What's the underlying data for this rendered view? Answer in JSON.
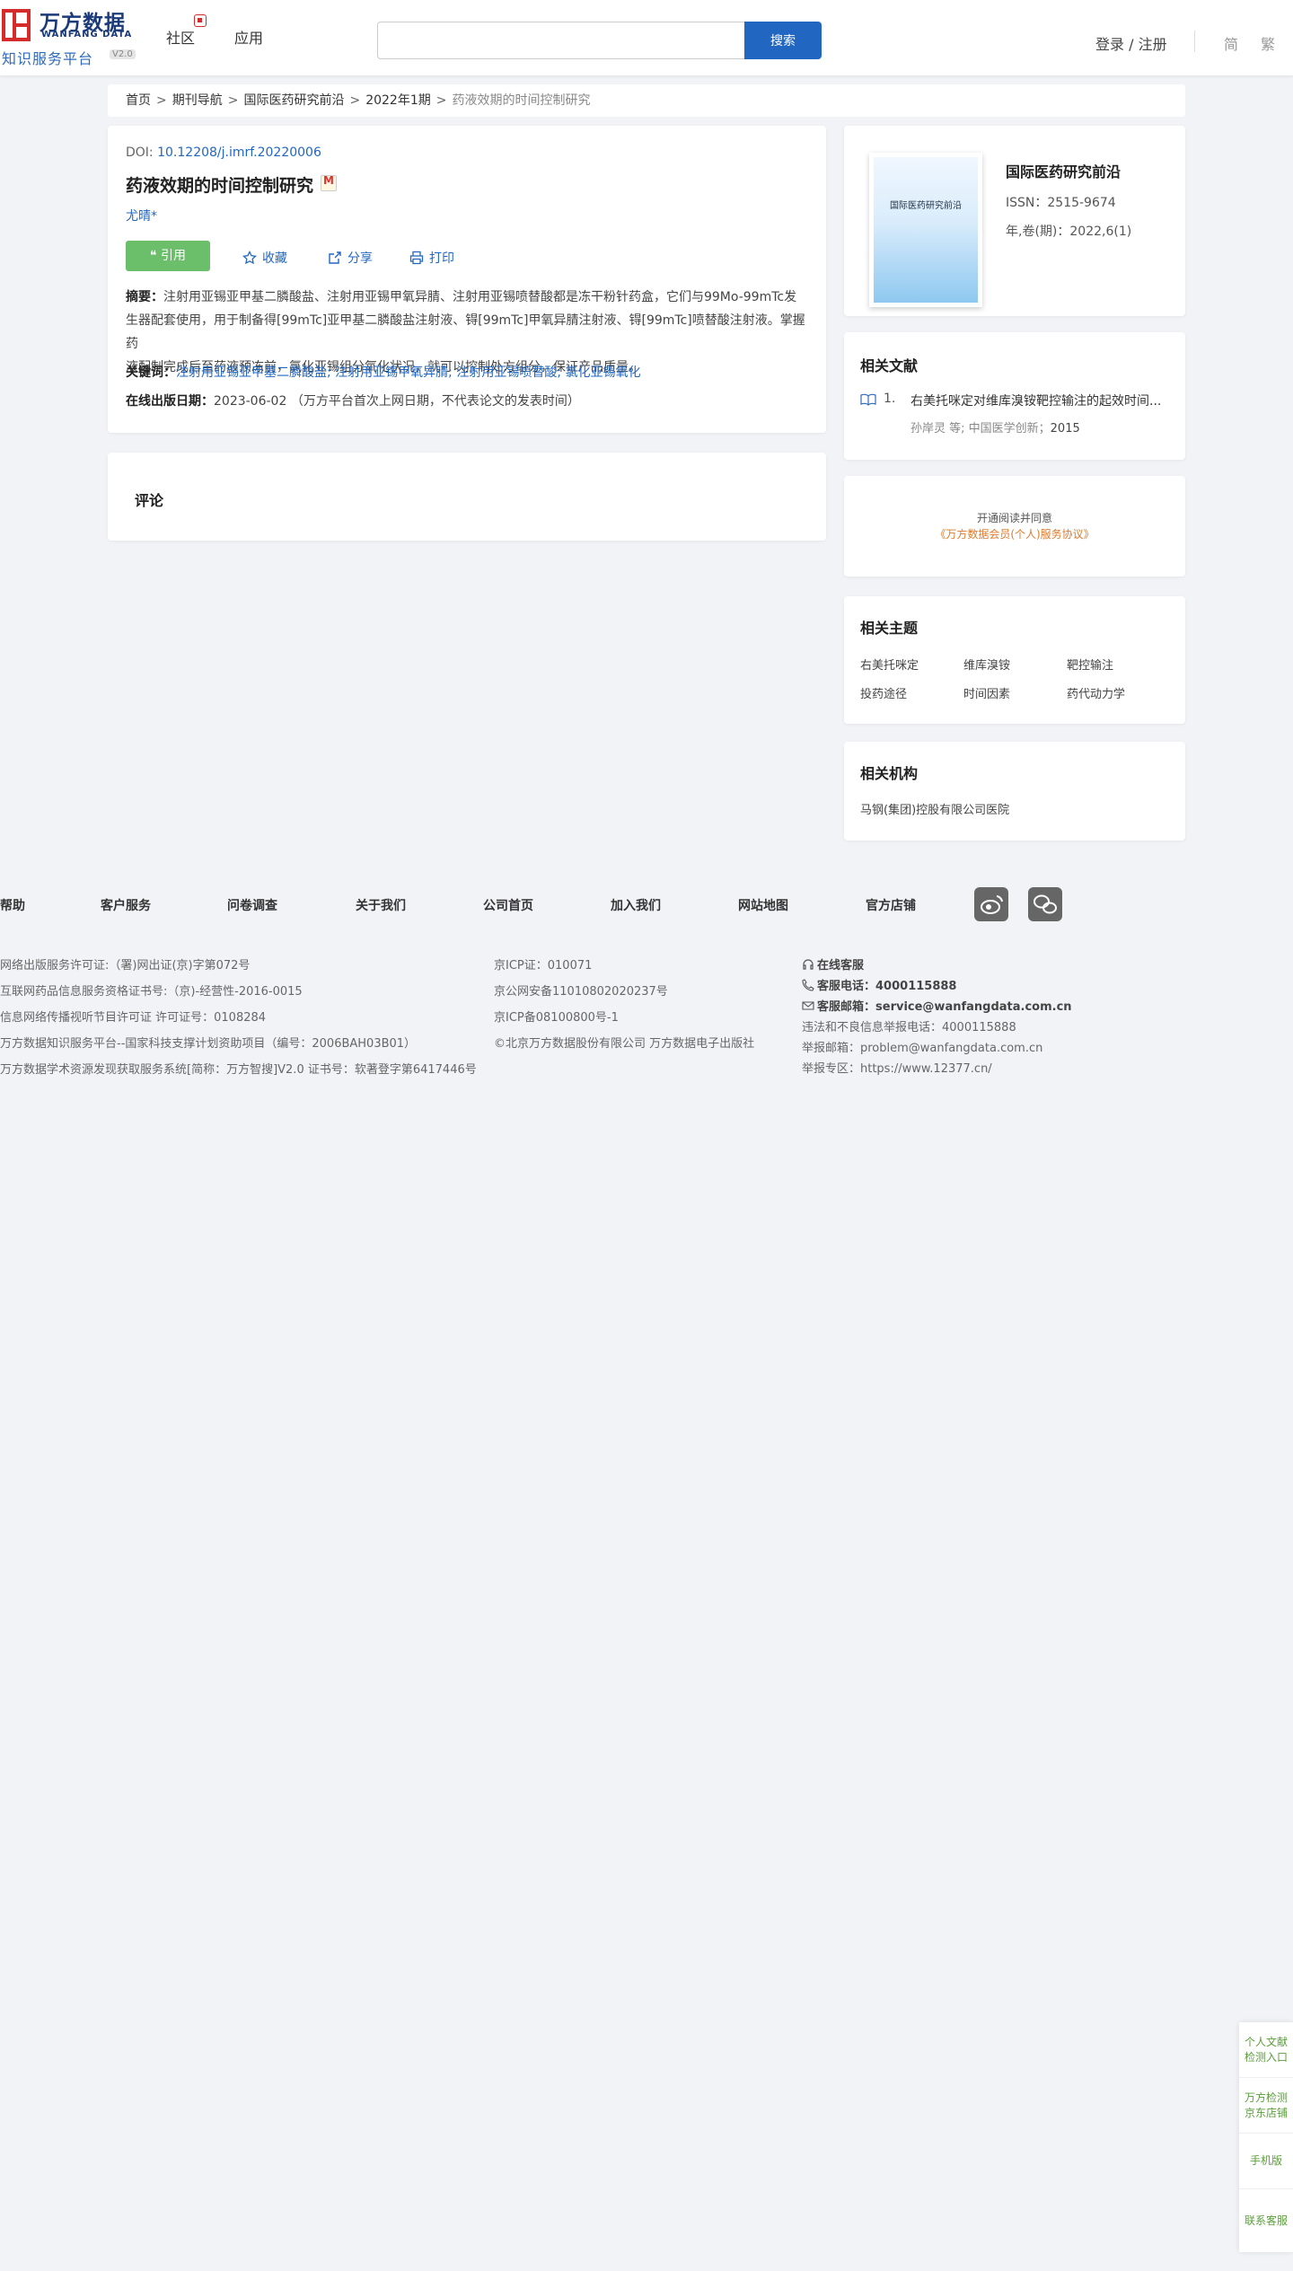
{
  "header": {
    "logo_cn": "万方数据",
    "logo_en": "WANFANG DATA",
    "logo_sub": "知识服务平台",
    "logo_version": "V2.0",
    "nav": [
      "社区",
      "应用"
    ],
    "search_placeholder": "",
    "search_button": "搜索",
    "login": "登录 / 注册",
    "lang_simplified": "简",
    "lang_traditional": "繁"
  },
  "breadcrumb": [
    "首页",
    "期刊导航",
    "国际医药研究前沿",
    "2022年1期",
    "药液效期的时间控制研究"
  ],
  "article": {
    "doi_label": "DOI: ",
    "doi": "10.12208/j.imrf.20220006",
    "title": "药液效期的时间控制研究",
    "author": "尤晴*",
    "actions": {
      "cite": "❝ 引用",
      "favorite": "收藏",
      "share": "分享",
      "print": "打印"
    },
    "abstract_label": "摘要：",
    "abstract_line1": "注射用亚锡亚甲基二膦酸盐、注射用亚锡甲氧异腈、注射用亚锡喷替酸都是冻干粉针药盒，它们与99Mo-99mTc发",
    "abstract_line2": "生器配套使用，用于制备得[99mTc]亚甲基二膦酸盐注射液、锝[99mTc]甲氧异腈注射液、锝[99mTc]喷替酸注射液。掌握药",
    "abstract_line3": "液配制完成后至药液预冻前，氯化亚锡组分氧化状况，就可以控制处方组分，保证产品质量。",
    "keywords_label": "关键词：",
    "keywords": [
      "注射用亚锡亚甲基二膦酸盐;",
      "注射用亚锡甲氧异腈;",
      "注射用亚锡喷替酸;",
      "氯化亚锡氧化"
    ],
    "pubdate_label": "在线出版日期：",
    "pubdate": "2023-06-02",
    "pubdate_note": "（万方平台首次上网日期，不代表论文的发表时间）"
  },
  "comments": {
    "title": "评论"
  },
  "journal": {
    "cover_title": "国际医药研究前沿",
    "name": "国际医药研究前沿",
    "issn": "ISSN：2515-9674",
    "volume": "年,卷(期)：2022,6(1)"
  },
  "related_docs": {
    "title": "相关文献",
    "items": [
      {
        "num": "1.",
        "title": "右美托咪定对维库溴铵靶控输注的起效时间...",
        "authors": "孙岸灵  等;  中国医学创新；",
        "year": "2015"
      }
    ]
  },
  "membership": {
    "line1": "开通阅读并同意",
    "line2": "《万方数据会员(个人)服务协议》"
  },
  "related_topics": {
    "title": "相关主题",
    "items": [
      "右美托咪定",
      "维库溴铵",
      "靶控输注",
      "投药途径",
      "时间因素",
      "药代动力学"
    ]
  },
  "related_orgs": {
    "title": "相关机构",
    "items": [
      "马钢(集团)控股有限公司医院"
    ]
  },
  "footer": {
    "nav": [
      "帮助",
      "客户服务",
      "问卷调查",
      "关于我们",
      "公司首页",
      "加入我们",
      "网站地图",
      "官方店铺"
    ],
    "col1": [
      "网络出版服务许可证:（署)网出证(京)字第072号",
      "互联网药品信息服务资格证书号:（京)-经营性-2016-0015",
      "信息网络传播视听节目许可证 许可证号：0108284",
      "万方数据知识服务平台--国家科技支撑计划资助项目（编号：2006BAH03B01）",
      "万方数据学术资源发现获取服务系统[简称：万方智搜]V2.0 证书号：软著登字第6417446号"
    ],
    "col2": [
      "京ICP证：010071",
      "京公网安备11010802020237号",
      "京ICP备08100800号-1",
      "©北京万方数据股份有限公司 万方数据电子出版社"
    ],
    "col3": {
      "online": "在线客服",
      "phone_label": "客服电话：",
      "phone": "4000115888",
      "email_label": "客服邮箱：",
      "email": "service@wanfangdata.com.cn",
      "report_phone": "违法和不良信息举报电话：4000115888",
      "report_email": "举报邮箱：problem@wanfangdata.com.cn",
      "report_zone": "举报专区：https://www.12377.cn/"
    }
  },
  "float_bar": [
    "个人文献检测入口",
    "万方检测京东店铺",
    "手机版",
    "联系客服"
  ]
}
